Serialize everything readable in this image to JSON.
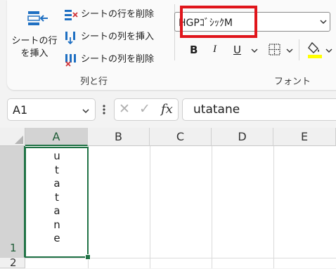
{
  "ribbon": {
    "insert_sheet_label_1": "シートの行",
    "insert_sheet_label_2": "を挿入",
    "delete_rows": "シートの行を削除",
    "insert_cols": "シートの列を挿入",
    "delete_cols": "シートの列を削除",
    "group_rows_cols": "列と行",
    "font_name": "HGPｺﾞｼｯｸM",
    "bold": "B",
    "italic": "I",
    "underline": "U",
    "group_font": "フォント"
  },
  "formula_bar": {
    "name_box": "A1",
    "cancel": "✕",
    "enter": "✓",
    "fx": "fx",
    "content": "utatane"
  },
  "grid": {
    "columns": [
      "A",
      "B",
      "C",
      "D",
      "E"
    ],
    "rows": [
      "1",
      "2"
    ],
    "cell_a1_chars": [
      "u",
      "t",
      "a",
      "t",
      "a",
      "n",
      "e"
    ]
  },
  "colors": {
    "accent": "#217346",
    "highlight": "#e0151b",
    "fill_color_bar": "#ffff00"
  }
}
